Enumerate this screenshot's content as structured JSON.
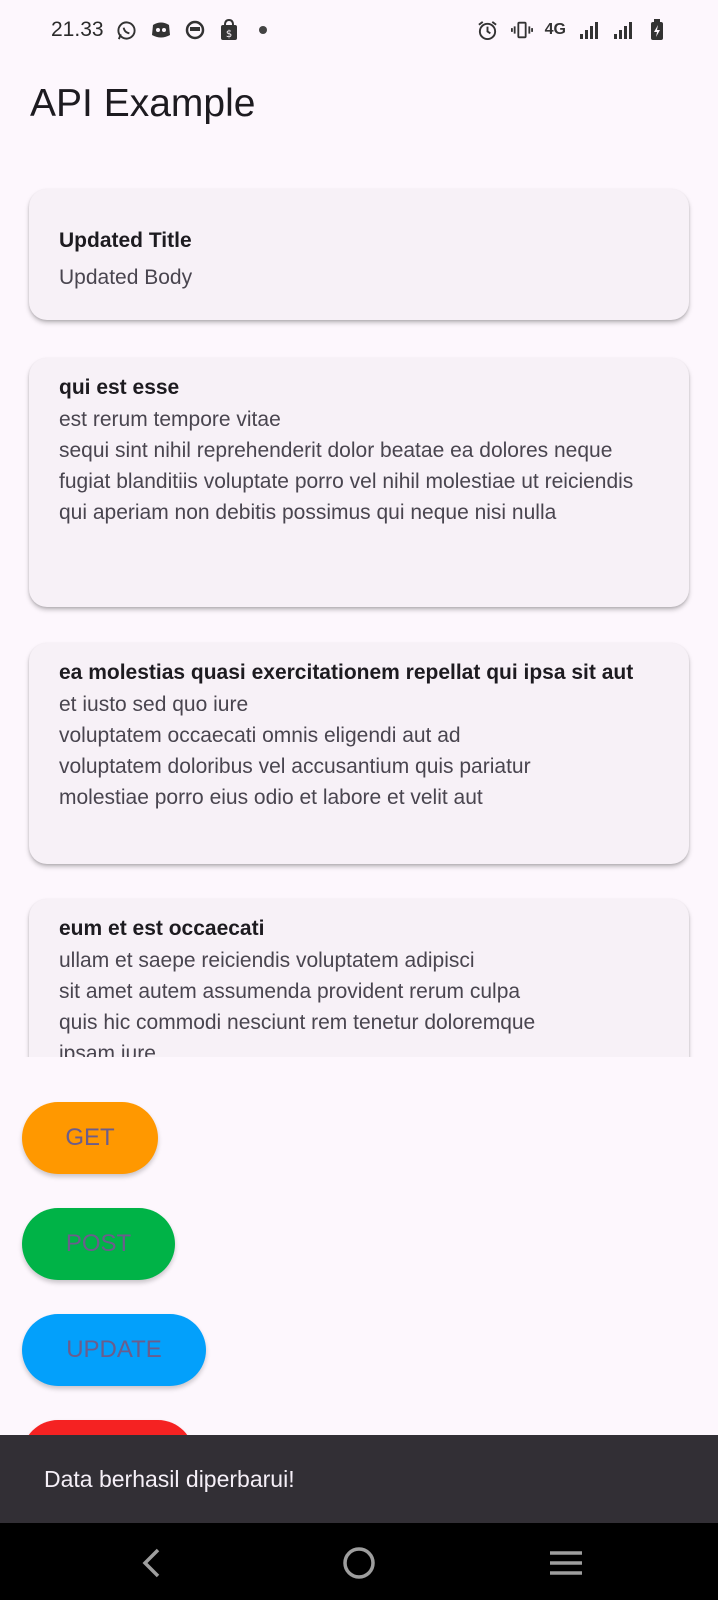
{
  "status_bar": {
    "time": "21.33",
    "network": "4G",
    "icons": [
      "whatsapp-icon",
      "discord-icon",
      "app-icon",
      "shop-icon",
      "dot-icon",
      "alarm-icon",
      "vibrate-icon",
      "signal-icon",
      "signal-icon",
      "battery-icon"
    ]
  },
  "app_bar": {
    "title": "API Example"
  },
  "posts": [
    {
      "title": "Updated Title",
      "body": "Updated Body"
    },
    {
      "title": "qui est esse",
      "body": "est rerum tempore vitae\nsequi sint nihil reprehenderit dolor beatae ea dolores neque\nfugiat blanditiis voluptate porro vel nihil molestiae ut reiciendis\nqui aperiam non debitis possimus qui neque nisi nulla"
    },
    {
      "title": "ea molestias quasi exercitationem repellat qui ipsa sit aut",
      "body": "et iusto sed quo iure\nvoluptatem occaecati omnis eligendi aut ad\nvoluptatem doloribus vel accusantium quis pariatur\nmolestiae porro eius odio et labore et velit aut"
    },
    {
      "title": "eum et est occaecati",
      "body": "ullam et saepe reiciendis voluptatem adipisci\nsit amet autem assumenda provident rerum culpa\nquis hic commodi nesciunt rem tenetur doloremque\nipsam iure"
    }
  ],
  "buttons": {
    "get": {
      "label": "GET",
      "color": "#ff9800"
    },
    "post": {
      "label": "POST",
      "color": "#00b347"
    },
    "update": {
      "label": "UPDATE",
      "color": "#03a0fb"
    },
    "delete": {
      "color": "#f52222"
    }
  },
  "snackbar": {
    "message": "Data berhasil diperbarui!"
  },
  "nav_bar": {
    "icons": [
      "back-icon",
      "home-icon",
      "recents-icon"
    ]
  }
}
